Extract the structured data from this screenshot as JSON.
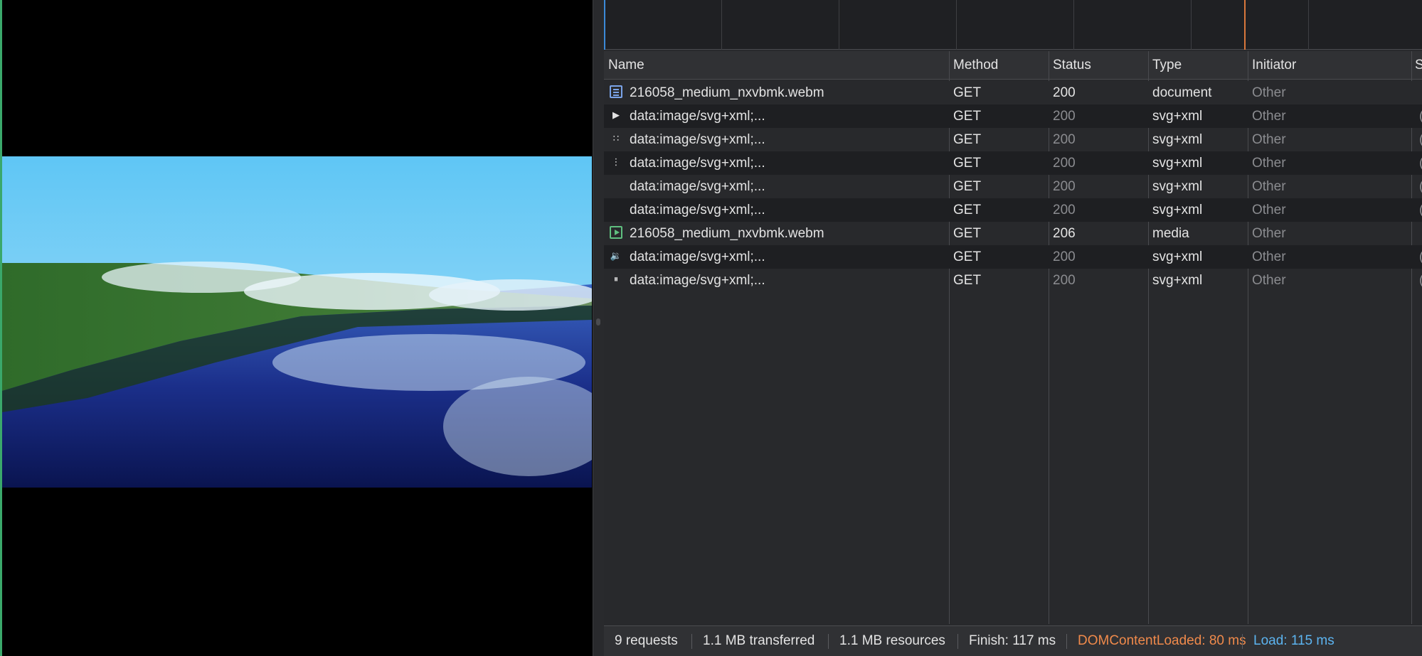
{
  "columns": {
    "name": "Name",
    "method": "Method",
    "status": "Status",
    "type": "Type",
    "initiator": "Initiator",
    "extra": "S"
  },
  "requests": [
    {
      "icon": "document-icon",
      "name": "216058_medium_nxvbmk.webm",
      "method": "GET",
      "status": "200",
      "type": "document",
      "initiator": "Other",
      "extra": ""
    },
    {
      "icon": "play-icon",
      "name": "data:image/svg+xml;...",
      "method": "GET",
      "status": "200",
      "type": "svg+xml",
      "initiator": "Other",
      "extra": "("
    },
    {
      "icon": "fullscreen-icon",
      "name": "data:image/svg+xml;...",
      "method": "GET",
      "status": "200",
      "type": "svg+xml",
      "initiator": "Other",
      "extra": "("
    },
    {
      "icon": "more-vertical-icon",
      "name": "data:image/svg+xml;...",
      "method": "GET",
      "status": "200",
      "type": "svg+xml",
      "initiator": "Other",
      "extra": "("
    },
    {
      "icon": "blank-icon",
      "name": "data:image/svg+xml;...",
      "method": "GET",
      "status": "200",
      "type": "svg+xml",
      "initiator": "Other",
      "extra": "("
    },
    {
      "icon": "blank-icon",
      "name": "data:image/svg+xml;...",
      "method": "GET",
      "status": "200",
      "type": "svg+xml",
      "initiator": "Other",
      "extra": "("
    },
    {
      "icon": "media-icon",
      "name": "216058_medium_nxvbmk.webm",
      "method": "GET",
      "status": "206",
      "type": "media",
      "initiator": "Other",
      "extra": ""
    },
    {
      "icon": "volume-icon",
      "name": "data:image/svg+xml;...",
      "method": "GET",
      "status": "200",
      "type": "svg+xml",
      "initiator": "Other",
      "extra": "("
    },
    {
      "icon": "pause-icon",
      "name": "data:image/svg+xml;...",
      "method": "GET",
      "status": "200",
      "type": "svg+xml",
      "initiator": "Other",
      "extra": "("
    }
  ],
  "statusbar": {
    "requests": "9 requests",
    "transferred": "1.1 MB transferred",
    "resources": "1.1 MB resources",
    "finish": "Finish: 117 ms",
    "dom_content_loaded": "DOMContentLoaded: 80 ms",
    "load": "Load: 115 ms"
  },
  "colors": {
    "dom_content_loaded": "#f08a4b",
    "load": "#5cb4f0",
    "document_icon": "#7aa3e8",
    "media_icon": "#5fbf7f"
  }
}
